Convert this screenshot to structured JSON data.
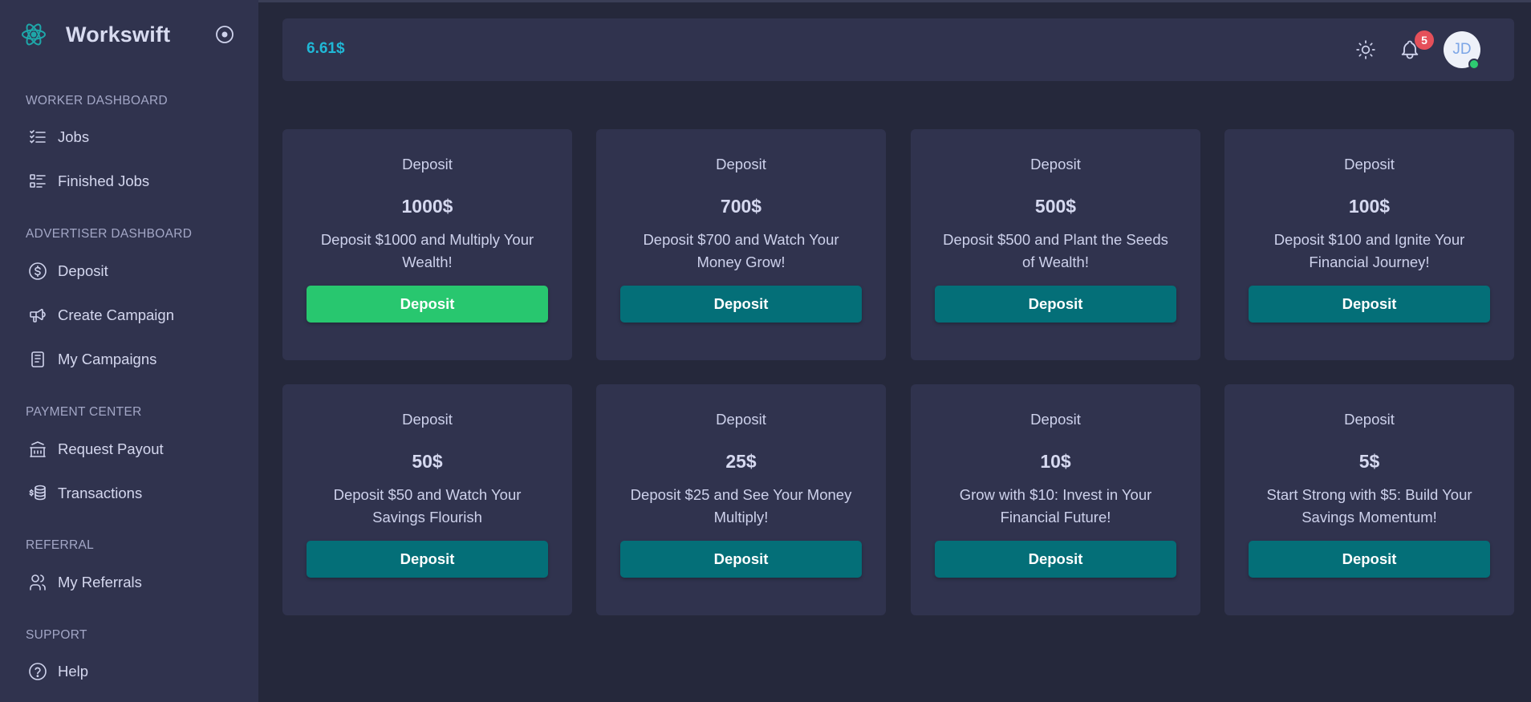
{
  "brand": {
    "name": "Workswift"
  },
  "sidebar": {
    "sections": [
      {
        "title": "WORKER DASHBOARD",
        "items": [
          {
            "label": "Jobs",
            "icon": "checklist-icon"
          },
          {
            "label": "Finished Jobs",
            "icon": "list-details-icon"
          }
        ]
      },
      {
        "title": "ADVERTISER DASHBOARD",
        "items": [
          {
            "label": "Deposit",
            "icon": "dollar-coin-icon"
          },
          {
            "label": "Create Campaign",
            "icon": "speakerphone-icon"
          },
          {
            "label": "My Campaigns",
            "icon": "document-icon"
          }
        ]
      },
      {
        "title": "PAYMENT CENTER",
        "items": [
          {
            "label": "Request Payout",
            "icon": "bank-icon"
          },
          {
            "label": "Transactions",
            "icon": "coins-icon"
          }
        ]
      },
      {
        "title": "REFERRAL",
        "items": [
          {
            "label": "My Referrals",
            "icon": "users-icon"
          }
        ]
      },
      {
        "title": "SUPPORT",
        "items": [
          {
            "label": "Help",
            "icon": "help-circle-icon"
          }
        ]
      }
    ]
  },
  "header": {
    "balance": "6.61$",
    "notifications_count": "5",
    "avatar_initials": "JD"
  },
  "cards": [
    {
      "title": "Deposit",
      "amount": "1000$",
      "description": "Deposit $1000 and Multiply Your Wealth!",
      "button": "Deposit",
      "active": true
    },
    {
      "title": "Deposit",
      "amount": "700$",
      "description": "Deposit $700 and Watch Your Money Grow!",
      "button": "Deposit",
      "active": false
    },
    {
      "title": "Deposit",
      "amount": "500$",
      "description": "Deposit $500 and Plant the Seeds of Wealth!",
      "button": "Deposit",
      "active": false
    },
    {
      "title": "Deposit",
      "amount": "100$",
      "description": "Deposit $100 and Ignite Your Financial Journey!",
      "button": "Deposit",
      "active": false
    },
    {
      "title": "Deposit",
      "amount": "50$",
      "description": "Deposit $50 and Watch Your Savings Flourish",
      "button": "Deposit",
      "active": false
    },
    {
      "title": "Deposit",
      "amount": "25$",
      "description": "Deposit $25 and See Your Money Multiply!",
      "button": "Deposit",
      "active": false
    },
    {
      "title": "Deposit",
      "amount": "10$",
      "description": "Grow with $10: Invest in Your Financial Future!",
      "button": "Deposit",
      "active": false
    },
    {
      "title": "Deposit",
      "amount": "5$",
      "description": "Start Strong with $5: Build Your Savings Momentum!",
      "button": "Deposit",
      "active": false
    }
  ],
  "colors": {
    "sidebar_bg": "#30334e",
    "page_bg": "#25283b",
    "accent_teal": "#046f78",
    "active_green": "#28c76f",
    "balance_cyan": "#20b8d6",
    "badge_red": "#e5505a"
  }
}
